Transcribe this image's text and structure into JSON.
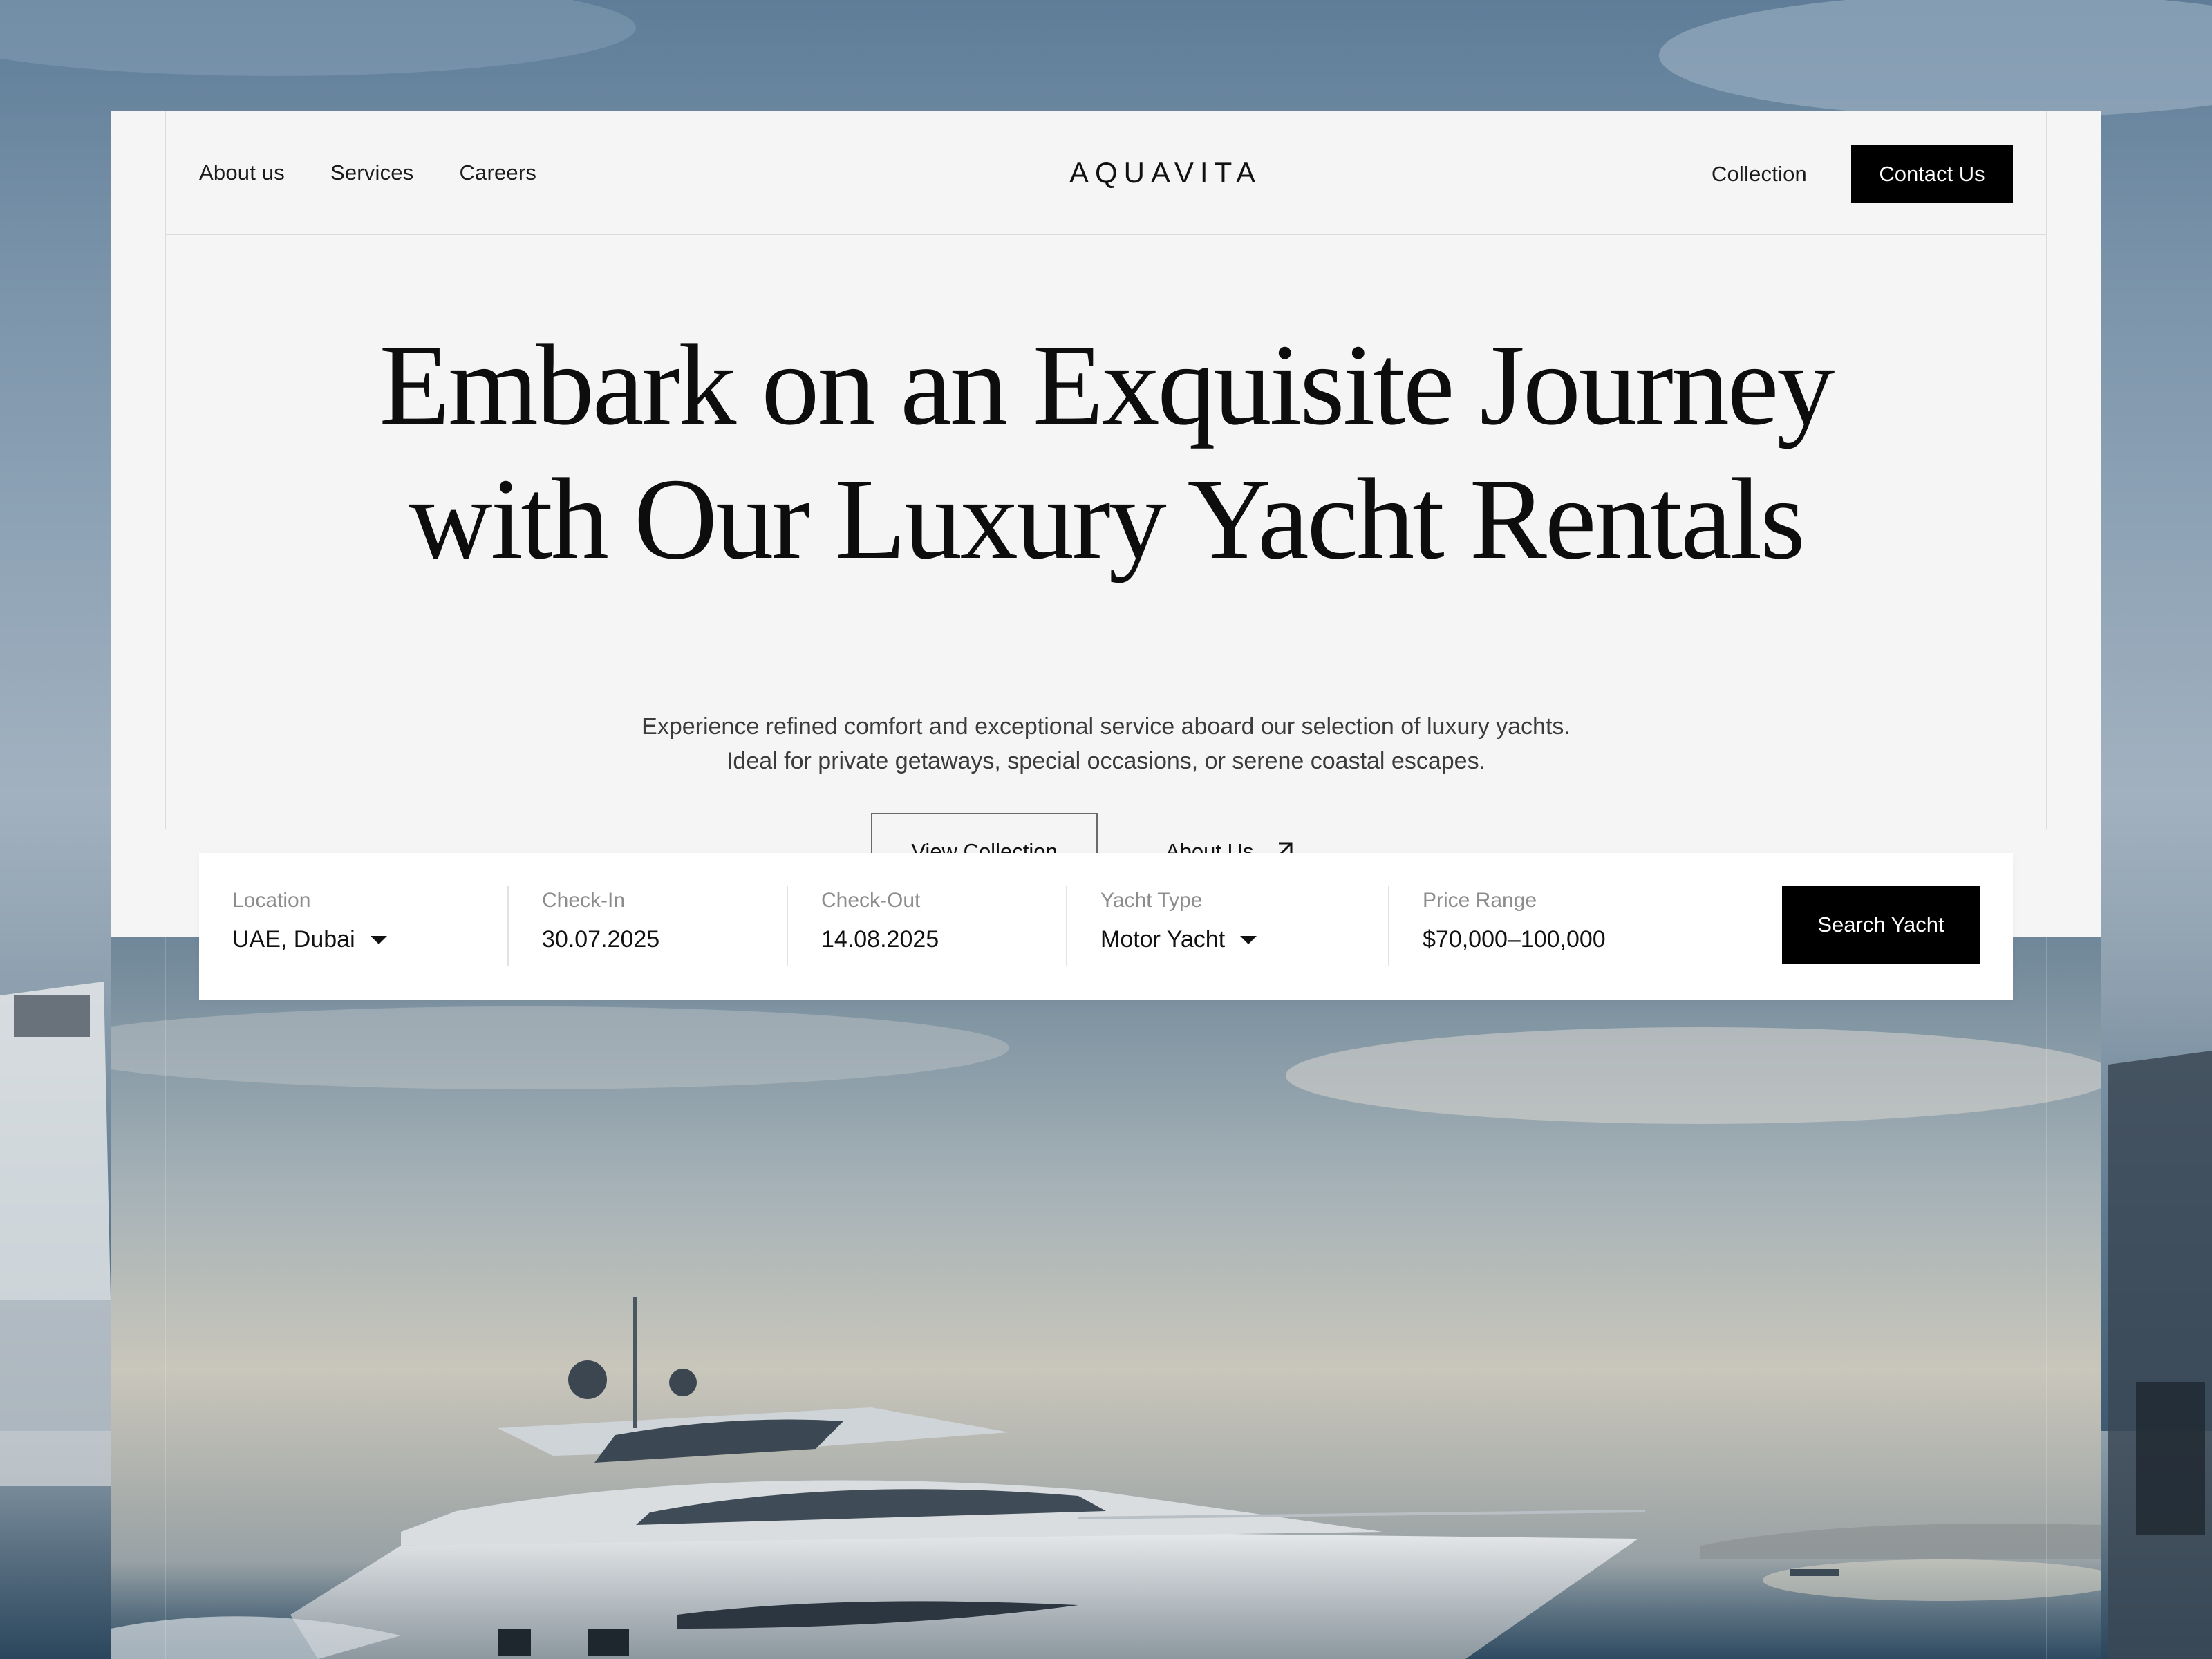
{
  "header": {
    "nav_left": [
      "About us",
      "Services",
      "Careers"
    ],
    "logo": "AQUAVITA",
    "collection_link": "Collection",
    "contact_button": "Contact Us"
  },
  "hero": {
    "title_line1": "Embark on an Exquisite Journey",
    "title_line2": "with Our Luxury Yacht Rentals",
    "subtitle_line1": "Experience refined comfort and exceptional service aboard our selection of luxury yachts.",
    "subtitle_line2": "Ideal for private getaways, special occasions, or serene coastal escapes.",
    "view_collection": "View Collection",
    "about_us": "About Us",
    "about_icon": "arrow-up-right-icon"
  },
  "search": {
    "location_label": "Location",
    "location_value": "UAE, Dubai",
    "checkin_label": "Check-In",
    "checkin_value": "30.07.2025",
    "checkout_label": "Check-Out",
    "checkout_value": "14.08.2025",
    "type_label": "Yacht Type",
    "type_value": "Motor Yacht",
    "price_label": "Price Range",
    "price_value": "$70,000–100,000",
    "search_button": "Search Yacht",
    "dropdown_icon": "caret-down-icon"
  },
  "colors": {
    "page_bg": "#f5f5f5",
    "primary": "#000000",
    "text": "#111111",
    "muted": "#8c8c8c"
  }
}
